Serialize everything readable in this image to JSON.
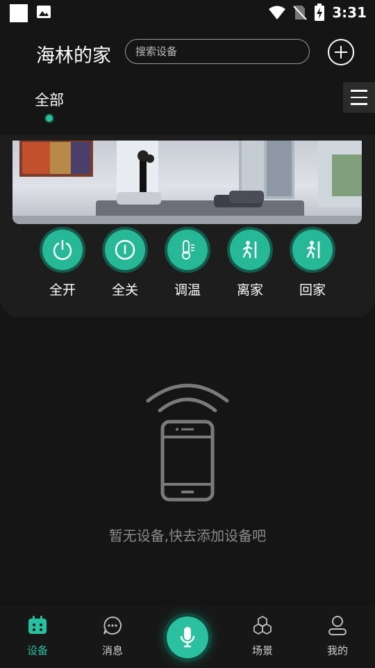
{
  "status_bar": {
    "time": "3:31",
    "icons": [
      "white-square-icon",
      "image-icon",
      "wifi-icon",
      "no-sim-icon",
      "battery-charging-icon"
    ]
  },
  "header": {
    "title": "海林的家",
    "search_placeholder": "搜索设备",
    "add_icon": "plus-icon"
  },
  "tabs": {
    "items": [
      {
        "label": "全部",
        "selected": true
      }
    ],
    "menu_icon": "hamburger-icon"
  },
  "banner": {
    "image": "living-room-photo"
  },
  "quick_actions": [
    {
      "label": "全开",
      "icon": "power-icon"
    },
    {
      "label": "全关",
      "icon": "power-off-icon"
    },
    {
      "label": "调温",
      "icon": "thermometer-icon"
    },
    {
      "label": "离家",
      "icon": "leave-home-icon"
    },
    {
      "label": "回家",
      "icon": "return-home-icon"
    }
  ],
  "empty_state": {
    "icon": "phone-wireless-icon",
    "message": "暂无设备,快去添加设备吧"
  },
  "bottom_nav": {
    "items": [
      {
        "label": "设备",
        "icon": "device-icon",
        "active": true
      },
      {
        "label": "消息",
        "icon": "message-icon",
        "active": false
      },
      {
        "label": "",
        "icon": "microphone-icon",
        "active": false
      },
      {
        "label": "场景",
        "icon": "scene-icon",
        "active": false
      },
      {
        "label": "我的",
        "icon": "profile-icon",
        "active": false
      }
    ]
  },
  "colors": {
    "accent": "#27c0a0",
    "background": "#151515",
    "card": "#1d1d1d",
    "muted_text": "#8a8a8a"
  }
}
